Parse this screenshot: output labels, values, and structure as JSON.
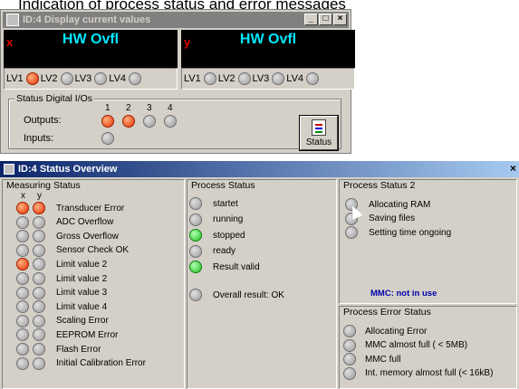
{
  "caption": "Indication of process status and error messages",
  "win1": {
    "title": "ID:4   Display current values",
    "min": "_",
    "max": "□",
    "close": "×",
    "displays": [
      {
        "axis": "x",
        "value": "HW Ovfl",
        "lv_labels": [
          "LV1",
          "LV2",
          "LV3",
          "LV4"
        ],
        "lv_states": [
          "red",
          "grey",
          "grey",
          "grey"
        ]
      },
      {
        "axis": "y",
        "value": "HW Ovfl",
        "lv_labels": [
          "LV1",
          "LV2",
          "LV3",
          "LV4"
        ],
        "lv_states": [
          "grey",
          "grey",
          "grey",
          "grey"
        ]
      }
    ],
    "dio": {
      "title": "Status Digital I/Os",
      "numbers": [
        "1",
        "2",
        "3",
        "4"
      ],
      "outputs_label": "Outputs:",
      "inputs_label": "Inputs:",
      "outputs": [
        "red",
        "red",
        "grey",
        "grey"
      ],
      "inputs": [
        "grey"
      ]
    },
    "status_button": "Status"
  },
  "win2": {
    "title": "ID:4   Status Overview",
    "close": "×",
    "measuring": {
      "title": "Measuring Status",
      "col_x": "x",
      "col_y": "y",
      "items": [
        {
          "label": "Transducer Error",
          "x": "red",
          "y": "red"
        },
        {
          "label": "ADC Overflow",
          "x": "grey",
          "y": "grey"
        },
        {
          "label": "Gross Overflow",
          "x": "grey",
          "y": "grey"
        },
        {
          "label": "Sensor Check OK",
          "x": "grey",
          "y": "grey"
        },
        {
          "label": "Limit value 2",
          "x": "red",
          "y": "grey"
        },
        {
          "label": "Limit value 2",
          "x": "grey",
          "y": "grey"
        },
        {
          "label": "Limit value 3",
          "x": "grey",
          "y": "grey"
        },
        {
          "label": "Limit value 4",
          "x": "grey",
          "y": "grey"
        },
        {
          "label": "Scaling Error",
          "x": "grey",
          "y": "grey"
        },
        {
          "label": "EEPROM Error",
          "x": "grey",
          "y": "grey"
        },
        {
          "label": "Flash Error",
          "x": "grey",
          "y": "grey"
        },
        {
          "label": "Initial Calibration Error",
          "x": "grey",
          "y": "grey"
        }
      ]
    },
    "process": {
      "title": "Process Status",
      "items": [
        {
          "label": "startet",
          "state": "grey"
        },
        {
          "label": "running",
          "state": "grey"
        },
        {
          "label": "stopped",
          "state": "green"
        },
        {
          "label": "ready",
          "state": "grey"
        },
        {
          "label": "Result valid",
          "state": "green"
        }
      ],
      "overall": {
        "label": "Overall result: OK",
        "state": "grey"
      }
    },
    "process2": {
      "title": "Process Status 2",
      "items": [
        {
          "label": "Allocating RAM",
          "state": "grey"
        },
        {
          "label": "Saving files",
          "state": "grey"
        },
        {
          "label": "Setting time ongoing",
          "state": "grey"
        }
      ],
      "mmc": "MMC: not in use"
    },
    "process_error": {
      "title": "Process Error Status",
      "items": [
        {
          "label": "Allocating Error",
          "state": "grey"
        },
        {
          "label": "MMC almost full ( < 5MB)",
          "state": "grey"
        },
        {
          "label": "MMC full",
          "state": "grey"
        },
        {
          "label": "Int. memory almost full (< 16kB)",
          "state": "grey"
        }
      ]
    }
  }
}
